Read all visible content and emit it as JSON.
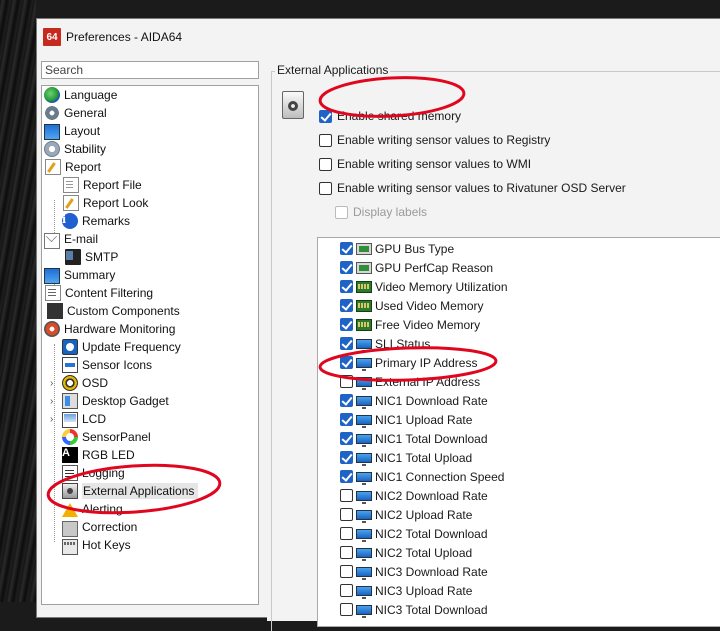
{
  "window": {
    "logo_text": "64",
    "title": "Preferences - AIDA64"
  },
  "search": {
    "placeholder": "Search"
  },
  "tree": [
    {
      "label": "Language",
      "icon": "globe-icon",
      "level": 0
    },
    {
      "label": "General",
      "icon": "gear-icon",
      "level": 0
    },
    {
      "label": "Layout",
      "icon": "monitor-icon",
      "level": 0
    },
    {
      "label": "Stability",
      "icon": "stability-icon",
      "level": 0
    },
    {
      "label": "Report",
      "icon": "report-icon",
      "level": 0
    },
    {
      "label": "Report File",
      "icon": "document-icon",
      "level": 1
    },
    {
      "label": "Report Look",
      "icon": "report-look-icon",
      "level": 1
    },
    {
      "label": "Remarks",
      "icon": "info-icon",
      "level": 1
    },
    {
      "label": "E-mail",
      "icon": "mail-icon",
      "level": 0
    },
    {
      "label": "SMTP",
      "icon": "phone-icon",
      "level": 1
    },
    {
      "label": "Summary",
      "icon": "monitor-icon",
      "level": 0
    },
    {
      "label": "Content Filtering",
      "icon": "filter-icon",
      "level": 0
    },
    {
      "label": "Custom Components",
      "icon": "chip-icon",
      "level": 0
    },
    {
      "label": "Hardware Monitoring",
      "icon": "hardware-monitoring-icon",
      "level": 0
    },
    {
      "label": "Update Frequency",
      "icon": "clock-icon",
      "level": 1
    },
    {
      "label": "Sensor Icons",
      "icon": "sensor-icons-icon",
      "level": 1
    },
    {
      "label": "OSD",
      "icon": "osd-icon",
      "level": 1,
      "expander": "›"
    },
    {
      "label": "Desktop Gadget",
      "icon": "gadget-icon",
      "level": 1,
      "expander": "›"
    },
    {
      "label": "LCD",
      "icon": "lcd-icon",
      "level": 1,
      "expander": "›"
    },
    {
      "label": "SensorPanel",
      "icon": "sensorpanel-icon",
      "level": 1
    },
    {
      "label": "RGB LED",
      "icon": "rgb-led-icon",
      "level": 1
    },
    {
      "label": "Logging",
      "icon": "logging-icon",
      "level": 1
    },
    {
      "label": "External Applications",
      "icon": "external-applications-icon",
      "level": 1,
      "selected": true
    },
    {
      "label": "Alerting",
      "icon": "warning-icon",
      "level": 1
    },
    {
      "label": "Correction",
      "icon": "correction-icon",
      "level": 1
    },
    {
      "label": "Hot Keys",
      "icon": "keyboard-icon",
      "level": 1
    }
  ],
  "rgb_icon_text": "A",
  "info_icon_text": "i",
  "group": {
    "title": "External Applications",
    "options": [
      {
        "label": "Enable shared memory",
        "checked": true,
        "disabled": false
      },
      {
        "label": "Enable writing sensor values to Registry",
        "checked": false,
        "disabled": false
      },
      {
        "label": "Enable writing sensor values to WMI",
        "checked": false,
        "disabled": false
      },
      {
        "label": "Enable writing sensor values to Rivatuner OSD Server",
        "checked": false,
        "disabled": false
      },
      {
        "label": "Display labels",
        "checked": false,
        "disabled": true
      }
    ]
  },
  "sensors": [
    {
      "label": "GPU Bus Type",
      "checked": true,
      "icon": "gpu-icon"
    },
    {
      "label": "GPU PerfCap Reason",
      "checked": true,
      "icon": "gpu-icon"
    },
    {
      "label": "Video Memory Utilization",
      "checked": true,
      "icon": "video-memory-icon"
    },
    {
      "label": "Used Video Memory",
      "checked": true,
      "icon": "video-memory-icon"
    },
    {
      "label": "Free Video Memory",
      "checked": true,
      "icon": "video-memory-icon"
    },
    {
      "label": "SLI Status",
      "checked": true,
      "icon": "network-icon"
    },
    {
      "label": "Primary IP Address",
      "checked": true,
      "icon": "network-icon"
    },
    {
      "label": "External IP Address",
      "checked": false,
      "icon": "network-icon"
    },
    {
      "label": "NIC1 Download Rate",
      "checked": true,
      "icon": "network-icon"
    },
    {
      "label": "NIC1 Upload Rate",
      "checked": true,
      "icon": "network-icon"
    },
    {
      "label": "NIC1 Total Download",
      "checked": true,
      "icon": "network-icon"
    },
    {
      "label": "NIC1 Total Upload",
      "checked": true,
      "icon": "network-icon"
    },
    {
      "label": "NIC1 Connection Speed",
      "checked": true,
      "icon": "network-icon"
    },
    {
      "label": "NIC2 Download Rate",
      "checked": false,
      "icon": "network-icon"
    },
    {
      "label": "NIC2 Upload Rate",
      "checked": false,
      "icon": "network-icon"
    },
    {
      "label": "NIC2 Total Download",
      "checked": false,
      "icon": "network-icon"
    },
    {
      "label": "NIC2 Total Upload",
      "checked": false,
      "icon": "network-icon"
    },
    {
      "label": "NIC3 Download Rate",
      "checked": false,
      "icon": "network-icon"
    },
    {
      "label": "NIC3 Upload Rate",
      "checked": false,
      "icon": "network-icon"
    },
    {
      "label": "NIC3 Total Download",
      "checked": false,
      "icon": "network-icon"
    }
  ],
  "colors": {
    "checkbox_accent": "#1f63c7",
    "annotation_red": "#e0061e",
    "app_logo_red": "#c62a1f"
  }
}
